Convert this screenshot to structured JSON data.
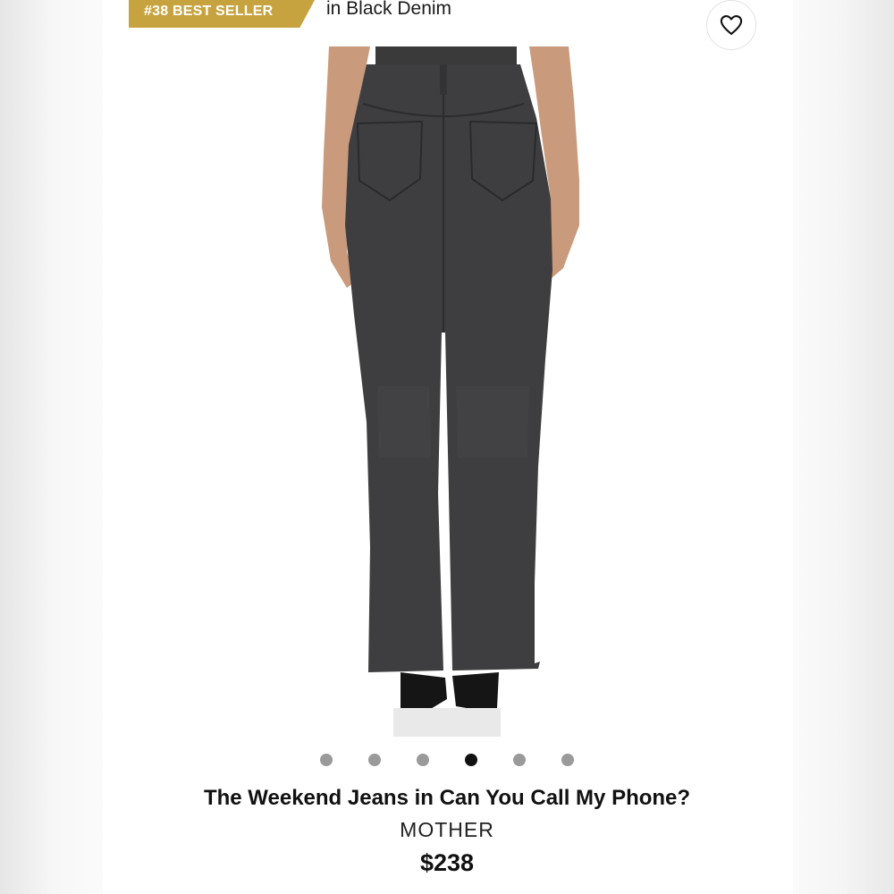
{
  "badge": {
    "label": "#38 BEST SELLER",
    "color": "#c7a33f"
  },
  "subtitle": "in Black Denim",
  "favorite": {
    "icon": "heart-outline-icon"
  },
  "gallery": {
    "dot_count": 6,
    "active_index": 3
  },
  "product": {
    "name": "The Weekend Jeans in Can You Call My Phone?",
    "brand": "MOTHER",
    "price": "$238"
  }
}
